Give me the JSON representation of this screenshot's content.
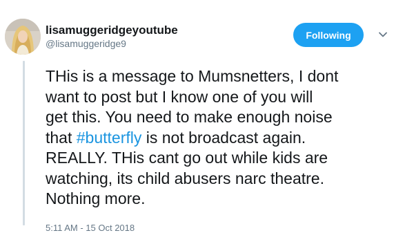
{
  "user": {
    "display_name": "lisamuggeridgeyoutube",
    "handle": "@lisamuggeridge9",
    "avatar_icon": "profile-photo"
  },
  "actions": {
    "follow_label": "Following",
    "menu_icon": "chevron-down-icon"
  },
  "tweet": {
    "line1": "THis is a message to Mumsnetters, I dont",
    "line2": "want to post but I know one of you will",
    "line3": "get this. You need to make enough noise",
    "line4_before": "that ",
    "line4_hashtag": "#butterfly",
    "line4_after": " is not broadcast again.",
    "line5": "REALLY. THis cant go out while kids are",
    "line6": "watching, its child abusers narc theatre.",
    "line7": "Nothing more."
  },
  "meta": {
    "timestamp": "5:11 AM - 15 Oct 2018"
  },
  "colors": {
    "accent": "#1da1f2",
    "hashtag": "#1b95e0",
    "secondary_text": "#657786",
    "thread_line": "#d3dce3"
  }
}
